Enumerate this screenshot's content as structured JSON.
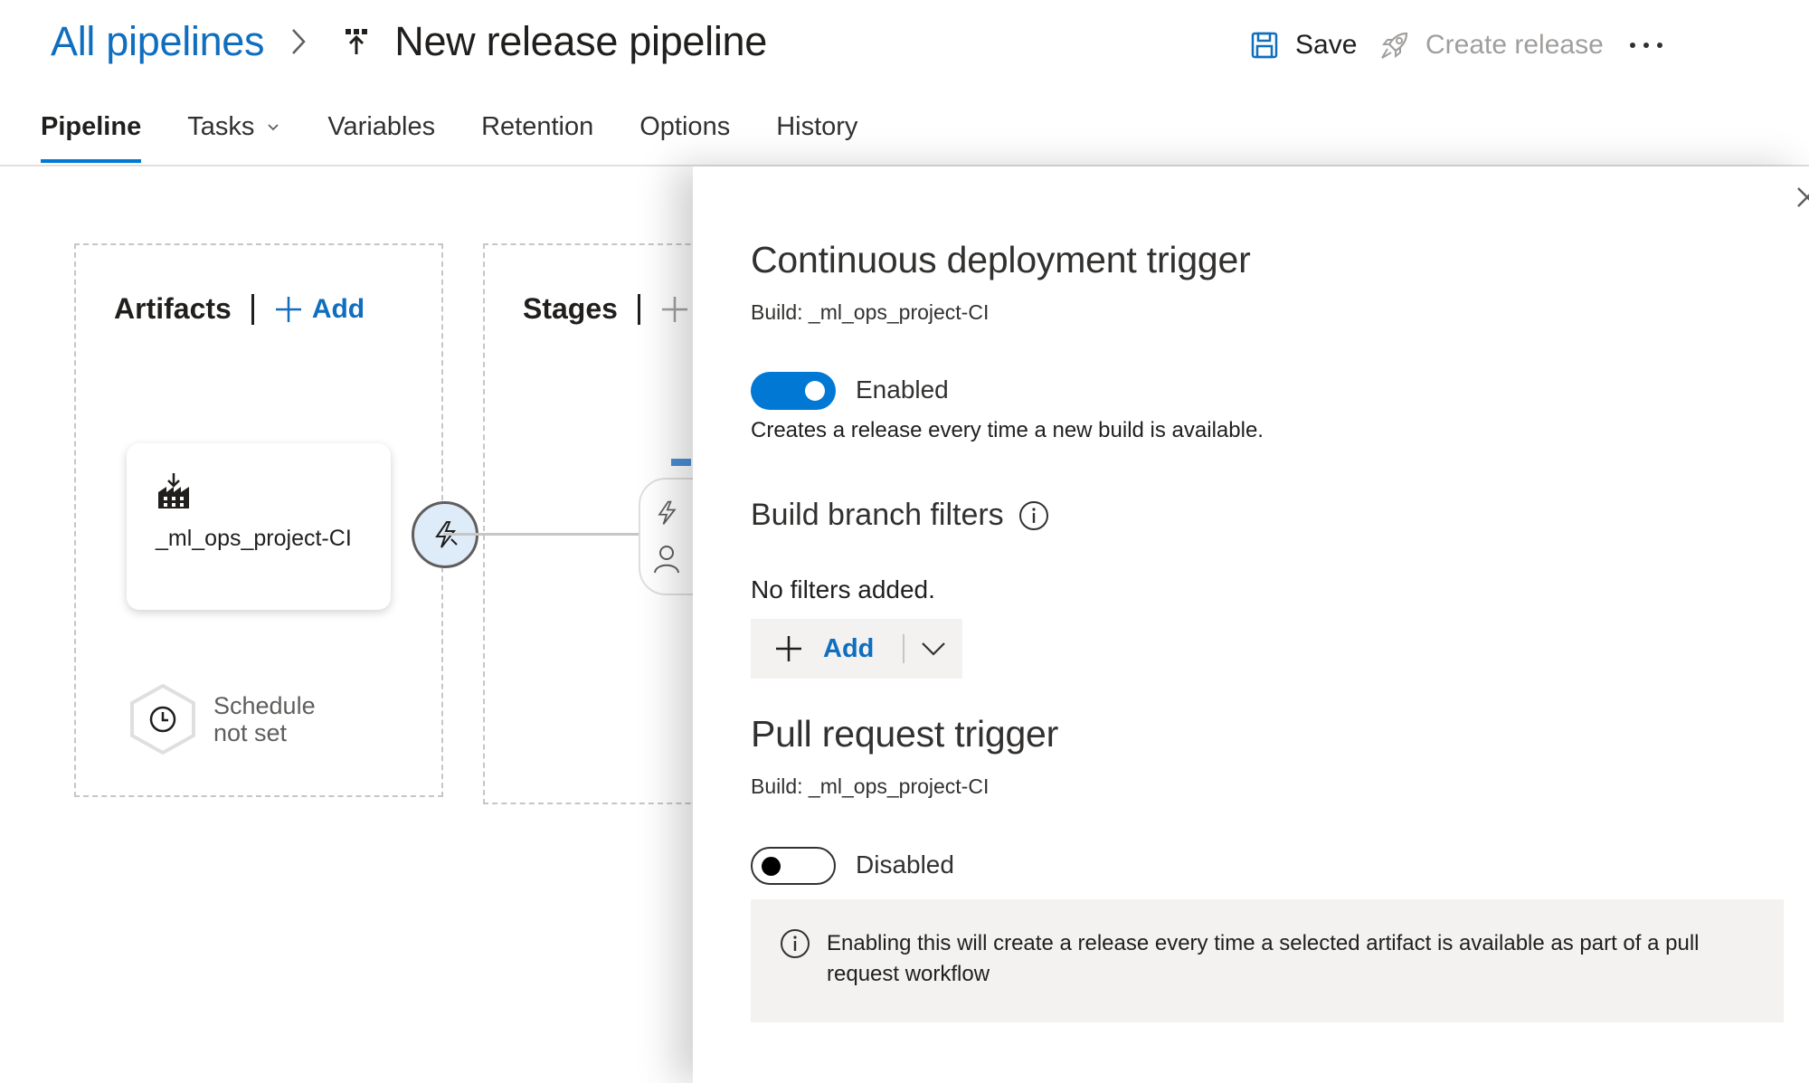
{
  "header": {
    "breadcrumb_root": "All pipelines",
    "pipeline_title": "New release pipeline",
    "save_label": "Save",
    "create_release_label": "Create release",
    "more_label": "···"
  },
  "tabs": [
    {
      "label": "Pipeline",
      "active": true
    },
    {
      "label": "Tasks",
      "has_dropdown": true
    },
    {
      "label": "Variables"
    },
    {
      "label": "Retention"
    },
    {
      "label": "Options"
    },
    {
      "label": "History"
    }
  ],
  "artifacts": {
    "title": "Artifacts",
    "add_label": "Add",
    "artifact_name": "_ml_ops_project-CI",
    "schedule_label": "Schedule not set"
  },
  "stages": {
    "title": "Stages"
  },
  "panel": {
    "cd_trigger": {
      "title": "Continuous deployment trigger",
      "build_label": "Build: _ml_ops_project-CI",
      "toggle_state_label": "Enabled",
      "enabled": true,
      "description": "Creates a release every time a new build is available."
    },
    "branch_filters": {
      "title": "Build branch filters",
      "empty_text": "No filters added.",
      "add_label": "Add"
    },
    "pr_trigger": {
      "title": "Pull request trigger",
      "build_label": "Build: _ml_ops_project-CI",
      "toggle_state_label": "Disabled",
      "enabled": false,
      "info_message": "Enabling this will create a release every time a selected artifact is available as part of a pull request workflow"
    }
  },
  "colors": {
    "accent": "#0078d4",
    "link": "#106ebe",
    "disabled_text": "#a19f9d",
    "panel_info_bg": "#f3f2f1"
  }
}
